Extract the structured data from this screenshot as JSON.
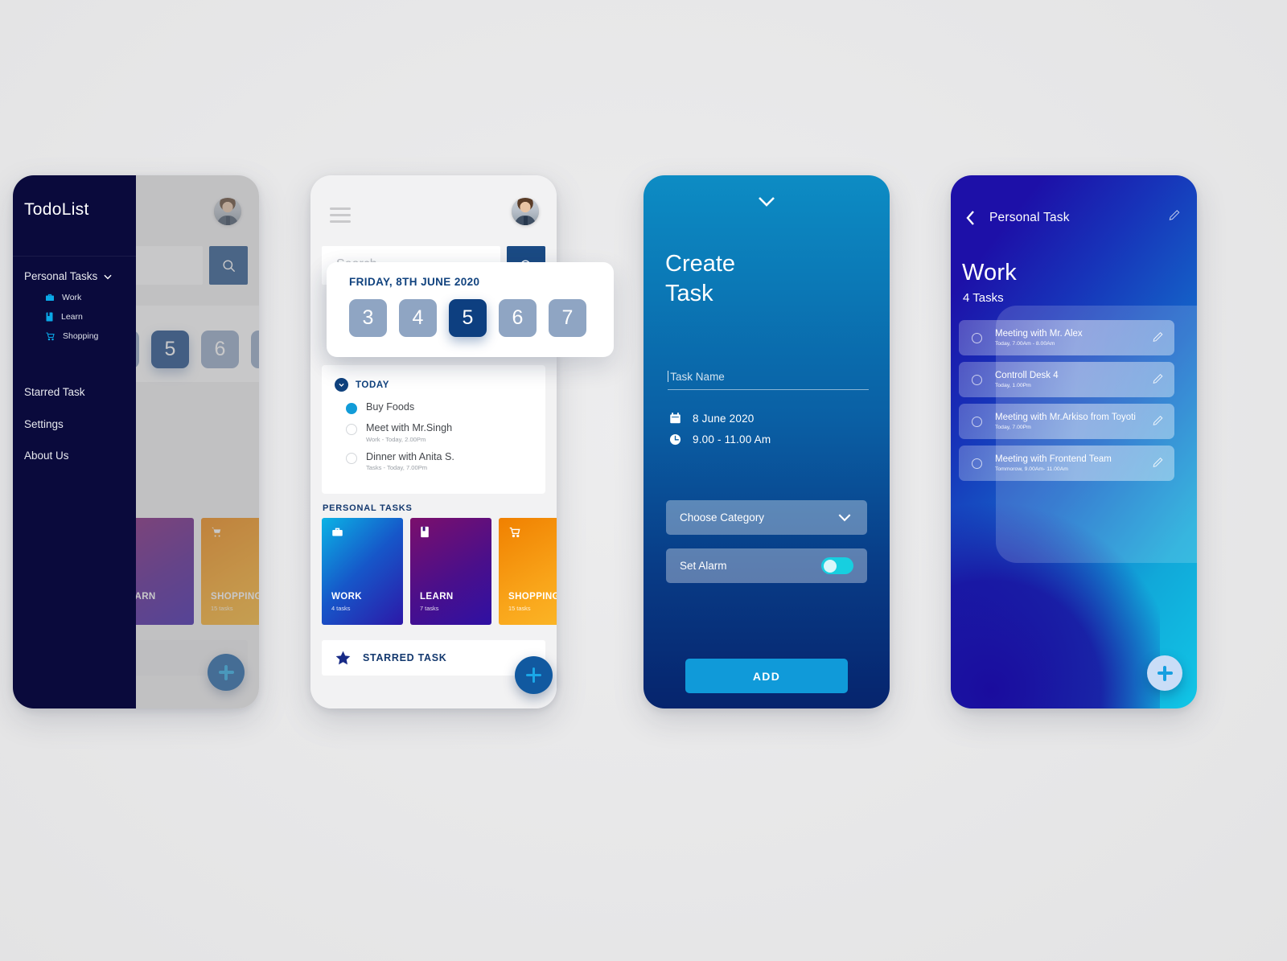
{
  "app": {
    "background_color": "#e9e9ea"
  },
  "screen1": {
    "name": "menu-drawer-screen",
    "drawer": {
      "brand": "TodoList",
      "group_label": "Personal Tasks",
      "chevron_icon": "chevron-down-icon",
      "sub_items": [
        {
          "label": "Work",
          "icon": "briefcase-icon",
          "color": "#0aa8e8"
        },
        {
          "label": "Learn",
          "icon": "book-icon",
          "color": "#0aa8e8"
        },
        {
          "label": "Shopping",
          "icon": "cart-icon",
          "color": "#0aa8e8"
        }
      ],
      "items": [
        {
          "label": "Starred Task"
        },
        {
          "label": "Settings"
        },
        {
          "label": "About Us"
        }
      ]
    }
  },
  "screen2": {
    "name": "home-screen",
    "header": {
      "menu_icon": "hamburger-icon",
      "avatar_icon": "user-avatar"
    },
    "search": {
      "placeholder": "Search",
      "value": "",
      "button_icon": "search-icon"
    },
    "date_popover": {
      "title": "FRIDAY, 8TH JUNE 2020",
      "days": [
        "3",
        "4",
        "5",
        "6",
        "7"
      ],
      "selected_day": "5"
    },
    "today": {
      "title": "TODAY",
      "chevron_icon": "chevron-down-icon",
      "items": [
        {
          "name": "Buy Foods",
          "sub": "",
          "done": true
        },
        {
          "name": "Meet with Mr.Singh",
          "sub": "Work - Today, 2.00Pm",
          "done": false
        },
        {
          "name": "Dinner with Anita S.",
          "sub": "Tasks - Today, 7.00Pm",
          "done": false
        }
      ]
    },
    "personal_tasks": {
      "title": "PERSONAL TASKS",
      "cards": [
        {
          "name": "WORK",
          "count": "4 tasks",
          "icon": "briefcase-icon"
        },
        {
          "name": "LEARN",
          "count": "7 tasks",
          "icon": "book-icon"
        },
        {
          "name": "SHOPPING",
          "count": "15 tasks",
          "icon": "cart-icon"
        }
      ]
    },
    "starred": {
      "label": "STARRED TASK",
      "icon": "star-icon"
    },
    "fab": {
      "icon": "plus-icon",
      "color": "#1159a0"
    }
  },
  "screen3": {
    "name": "create-task-screen",
    "collapse_icon": "chevron-down-icon",
    "title_line1": "Create",
    "title_line2": "Task",
    "task_name": {
      "placeholder": "Task Name",
      "value": ""
    },
    "date": {
      "icon": "calendar-icon",
      "value": "8 June 2020"
    },
    "time": {
      "icon": "clock-icon",
      "value": "9.00 - 11.00 Am"
    },
    "category": {
      "label": "Choose Category",
      "chevron_icon": "chevron-down-icon"
    },
    "alarm": {
      "label": "Set Alarm",
      "enabled": true,
      "toggle_color": "#17cfe0"
    },
    "add_button": {
      "label": "ADD",
      "color": "#109ad9"
    }
  },
  "screen4": {
    "name": "task-list-screen",
    "back_icon": "chevron-left-icon",
    "breadcrumb": "Personal Task",
    "edit_icon": "pencil-icon",
    "title": "Work",
    "subtitle": "4 Tasks",
    "tasks": [
      {
        "name": "Meeting with Mr. Alex",
        "sub": "Today, 7.00Am - 8.00Am",
        "edit_icon": "pencil-icon"
      },
      {
        "name": "Controll Desk 4",
        "sub": "Today, 1.00Pm",
        "edit_icon": "pencil-icon"
      },
      {
        "name": "Meeting with Mr.Arkiso from Toyoti",
        "sub": "Today, 7.00Pm",
        "edit_icon": "pencil-icon"
      },
      {
        "name": "Meeting with Frontend Team",
        "sub": "Tommorow, 9.00Am- 11.00Am",
        "edit_icon": "pencil-icon"
      }
    ],
    "fab": {
      "icon": "plus-icon",
      "color": "#c9ddf7"
    }
  }
}
